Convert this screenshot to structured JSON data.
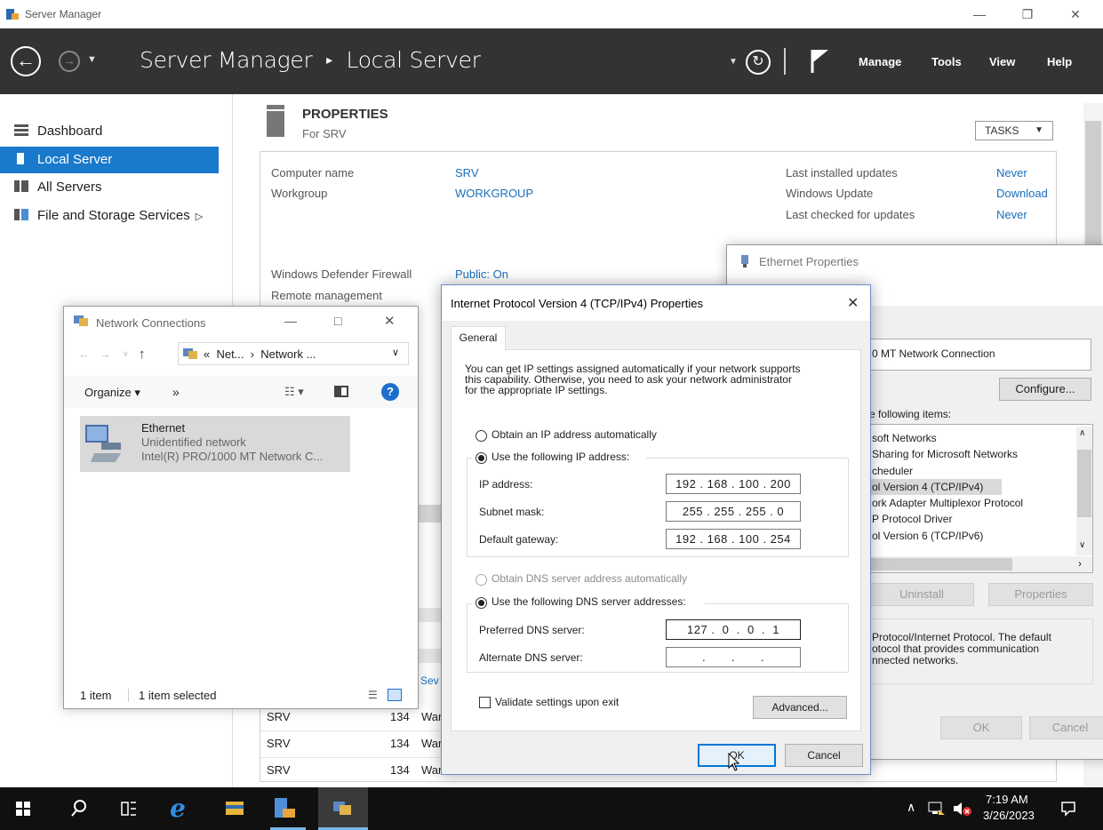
{
  "window": {
    "title": "Server Manager",
    "breadcrumb_root": "Server Manager",
    "breadcrumb_sep": "▸",
    "breadcrumb_current": "Local Server",
    "menus": [
      "Manage",
      "Tools",
      "View",
      "Help"
    ]
  },
  "sidebar": {
    "items": [
      {
        "label": "Dashboard",
        "active": false
      },
      {
        "label": "Local Server",
        "active": true
      },
      {
        "label": "All Servers",
        "active": false
      },
      {
        "label": "File and Storage Services",
        "active": false
      }
    ]
  },
  "properties": {
    "heading": "PROPERTIES",
    "subheading": "For SRV",
    "tasks_label": "TASKS",
    "left": [
      {
        "label": "Computer name",
        "value": "SRV"
      },
      {
        "label": "Workgroup",
        "value": "WORKGROUP"
      },
      {
        "label": "Windows Defender Firewall",
        "value": "Public: On"
      },
      {
        "label": "Remote management",
        "value": ""
      }
    ],
    "right": [
      {
        "label": "Last installed updates",
        "value": "Never"
      },
      {
        "label": "Windows Update",
        "value": "Download"
      },
      {
        "label": "Last checked for updates",
        "value": "Never"
      }
    ]
  },
  "events": {
    "col_label": "Sev",
    "rows": [
      {
        "server": "SRV",
        "id": "134",
        "sev": "War"
      },
      {
        "server": "SRV",
        "id": "134",
        "sev": "War"
      },
      {
        "server": "SRV",
        "id": "134",
        "sev": "War"
      }
    ]
  },
  "network_connections": {
    "title": "Network Connections",
    "address": "«  Net...  ›  Network ...",
    "organize": "Organize ▾",
    "more": "»",
    "item": {
      "name": "Ethernet",
      "status": "Unidentified network",
      "adapter": "Intel(R) PRO/1000 MT Network C..."
    },
    "status_count": "1 item",
    "status_selected": "1 item selected"
  },
  "ethernet_properties": {
    "title": "Ethernet Properties",
    "adapter_text": "0 MT Network Connection",
    "configure": "Configure...",
    "items_label": "e following items:",
    "items": [
      "soft Networks",
      " Sharing for Microsoft Networks",
      "cheduler",
      "ol Version 4 (TCP/IPv4)",
      "ork Adapter Multiplexor Protocol",
      "P Protocol Driver",
      "ol Version 6 (TCP/IPv6)"
    ],
    "uninstall": "Uninstall",
    "properties": "Properties",
    "description": [
      " Protocol/Internet Protocol. The default",
      "otocol that provides communication",
      "nnected networks."
    ],
    "ok": "OK",
    "cancel": "Cancel"
  },
  "ipv4_dialog": {
    "title": "Internet Protocol Version 4 (TCP/IPv4) Properties",
    "tab": "General",
    "intro": [
      "You can get IP settings assigned automatically if your network supports",
      "this capability. Otherwise, you need to ask your network administrator",
      "for the appropriate IP settings."
    ],
    "auto_ip": "Obtain an IP address automatically",
    "manual_ip": "Use the following IP address:",
    "ip_label": "IP address:",
    "ip_value": "192 . 168 . 100 . 200",
    "mask_label": "Subnet mask:",
    "mask_value": "255 . 255 . 255 .  0",
    "gateway_label": "Default gateway:",
    "gateway_value": "192 . 168 . 100 . 254",
    "auto_dns": "Obtain DNS server address automatically",
    "manual_dns": "Use the following DNS server addresses:",
    "pref_dns_label": "Preferred DNS server:",
    "pref_dns_value": "127 .  0  .  0  .  1",
    "alt_dns_label": "Alternate DNS server:",
    "alt_dns_value": ".       .       .",
    "validate": "Validate settings upon exit",
    "advanced": "Advanced...",
    "ok": "OK",
    "cancel": "Cancel"
  },
  "taskbar": {
    "time": "7:19 AM",
    "date": "3/26/2023"
  },
  "colors": {
    "header": "#333333",
    "accent": "#1979ca",
    "link": "#1a6fbd",
    "taskbar": "#101010"
  }
}
